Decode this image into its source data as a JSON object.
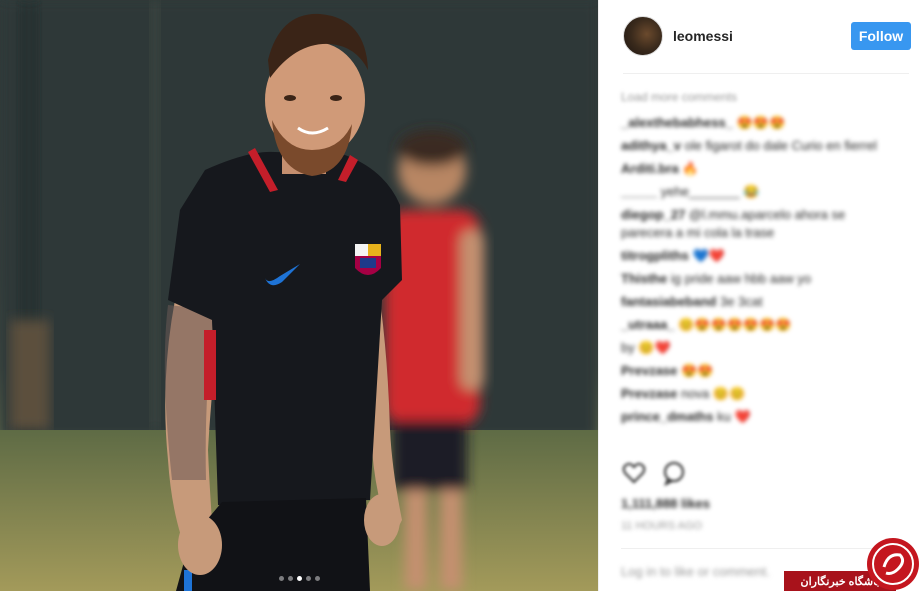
{
  "post": {
    "carousel": {
      "count": 5,
      "active_index": 2
    }
  },
  "header": {
    "username": "leomessi",
    "follow_label": "Follow"
  },
  "comments": {
    "load_more": "Load more comments",
    "items": [
      {
        "user": "_alexthebabhess_",
        "text": "",
        "emoji": "😍😍😍"
      },
      {
        "user": "adithya_v",
        "text": "ole figarot do dale Curio en fierrel",
        "emoji": ""
      },
      {
        "user": "Arditi.bra",
        "text": "",
        "emoji": "🔥"
      },
      {
        "user": "_____",
        "text": "yehe_______",
        "emoji": "😂"
      },
      {
        "user": "diegop_27",
        "text": "@l.mmu.aparcelo ahora se parecera a mi cola la trase",
        "emoji": ""
      },
      {
        "user": "titrogpliths",
        "text": "",
        "emoji": "💙❤️"
      },
      {
        "user": "Thisthe",
        "text": "ig pride aaw hbb aaw yo",
        "emoji": ""
      },
      {
        "user": "fantasiabeband",
        "text": "3e 3cat",
        "emoji": ""
      },
      {
        "user": "_utraaa_",
        "text": "",
        "emoji": "😊😍😍😍😍😍😍"
      },
      {
        "user": "",
        "text": "by",
        "emoji": "😊❤️"
      },
      {
        "user": "Prevzase",
        "text": "",
        "emoji": "😍😍"
      },
      {
        "user": "Prevzase",
        "text": "nova",
        "emoji": "😊😊"
      },
      {
        "user": "prince_dmaths",
        "text": "ku",
        "emoji": "❤️"
      }
    ]
  },
  "likes_text": "1,111,888 likes",
  "timestamp_text": "11 HOURS AGO",
  "add_comment_placeholder": "Log in to like or comment.",
  "watermark": {
    "label": "باشگاه خبرنگاران"
  },
  "colors": {
    "follow_button": "#3897f0",
    "watermark": "#a8121b"
  }
}
